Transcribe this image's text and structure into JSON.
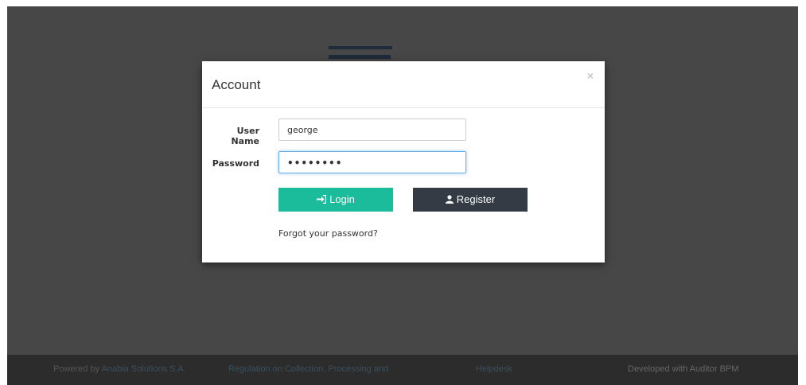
{
  "modal": {
    "title": "Account",
    "close_glyph": "×",
    "username_label": "User Name",
    "username_value": "george",
    "password_label": "Password",
    "password_value": "••••••••",
    "login_label": "Login",
    "register_label": "Register",
    "forgot_label": "Forgot your password?"
  },
  "icons": {
    "login": "sign-in-icon",
    "register": "user-icon",
    "close": "close-icon"
  },
  "footer": {
    "powered_prefix": "Powered by ",
    "powered_link": "Anabia Solutions S.A.",
    "regulation": "Regulation on Collection, Processing and",
    "helpdesk": "Helpdesk",
    "developed": "Developed with Auditor BPM"
  },
  "colors": {
    "login_button": "#1abc9c",
    "register_button": "#343b44",
    "backdrop": "#474747"
  }
}
